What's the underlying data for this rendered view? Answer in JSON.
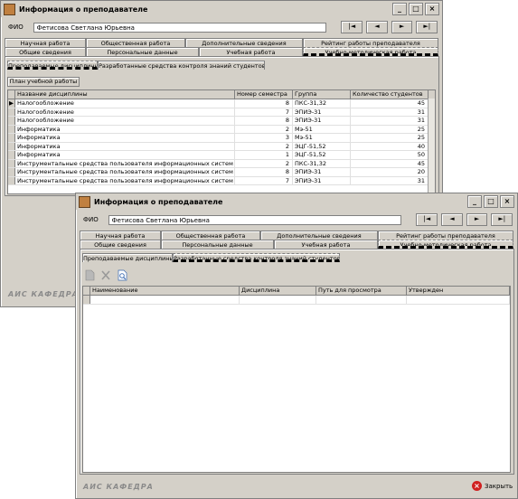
{
  "window_back": {
    "title": "Информация о преподавателе",
    "fio_label": "ФИО",
    "fio_value": "Фетисова Светлана Юрьевна",
    "nav": [
      "|◄",
      "◄",
      "►",
      "►|"
    ],
    "tabs_row1": [
      "Научная работа",
      "Общественная работа",
      "Дополнительные сведения",
      "Рейтинг работы преподавателя"
    ],
    "tabs_row2": [
      "Общие сведения",
      "Персональные данные",
      "Учебная работа",
      "Учебно-методическая работа"
    ],
    "subtabs": [
      "Преподаваемые дисциплины",
      "Разработанные средства контроля знаний студентов"
    ],
    "plan_button": "План учебной работы",
    "columns": [
      "Название дисциплины",
      "Номер семестра",
      "Группа",
      "Количество студентов"
    ],
    "rows": [
      {
        "name": "Налогообложение",
        "sem": "8",
        "group": "ПКС-31,32",
        "count": "45"
      },
      {
        "name": "Налогообложение",
        "sem": "7",
        "group": "ЭПИЭ-31",
        "count": "31"
      },
      {
        "name": "Налогообложение",
        "sem": "8",
        "group": "ЭПИЭ-31",
        "count": "31"
      },
      {
        "name": "Информатика",
        "sem": "2",
        "group": "Мэ-51",
        "count": "25"
      },
      {
        "name": "Информатика",
        "sem": "3",
        "group": "Мэ-51",
        "count": "25"
      },
      {
        "name": "Информатика",
        "sem": "2",
        "group": "ЭЦГ-51,52",
        "count": "40"
      },
      {
        "name": "Информатика",
        "sem": "1",
        "group": "ЭЦГ-51,52",
        "count": "50"
      },
      {
        "name": "Инструментальные средства пользователя информационных систем",
        "sem": "2",
        "group": "ПКС-31,32",
        "count": "45"
      },
      {
        "name": "Инструментальные средства пользователя информационных систем",
        "sem": "8",
        "group": "ЭПИЭ-31",
        "count": "20"
      },
      {
        "name": "Инструментальные средства пользователя информационных систем",
        "sem": "7",
        "group": "ЭПИЭ-31",
        "count": "31"
      }
    ],
    "status": "АИС КАФЕДРА"
  },
  "window_front": {
    "title": "Информация о преподавателе",
    "fio_label": "ФИО",
    "fio_value": "Фетисова Светлана Юрьевна",
    "nav": [
      "|◄",
      "◄",
      "►",
      "►|"
    ],
    "tabs_row1": [
      "Научная работа",
      "Общественная работа",
      "Дополнительные сведения",
      "Рейтинг работы преподавателя"
    ],
    "tabs_row2": [
      "Общие сведения",
      "Персональные данные",
      "Учебная работа",
      "Учебно-методическая работа"
    ],
    "subtabs": [
      "Преподаваемые дисциплины",
      "Разработанные средства контроля знаний студентов"
    ],
    "columns": [
      "Наименование",
      "Дисциплина",
      "Путь для просмотра",
      "Утвержден"
    ],
    "status": "АИС КАФЕДРА",
    "close_label": "Закрыть"
  }
}
